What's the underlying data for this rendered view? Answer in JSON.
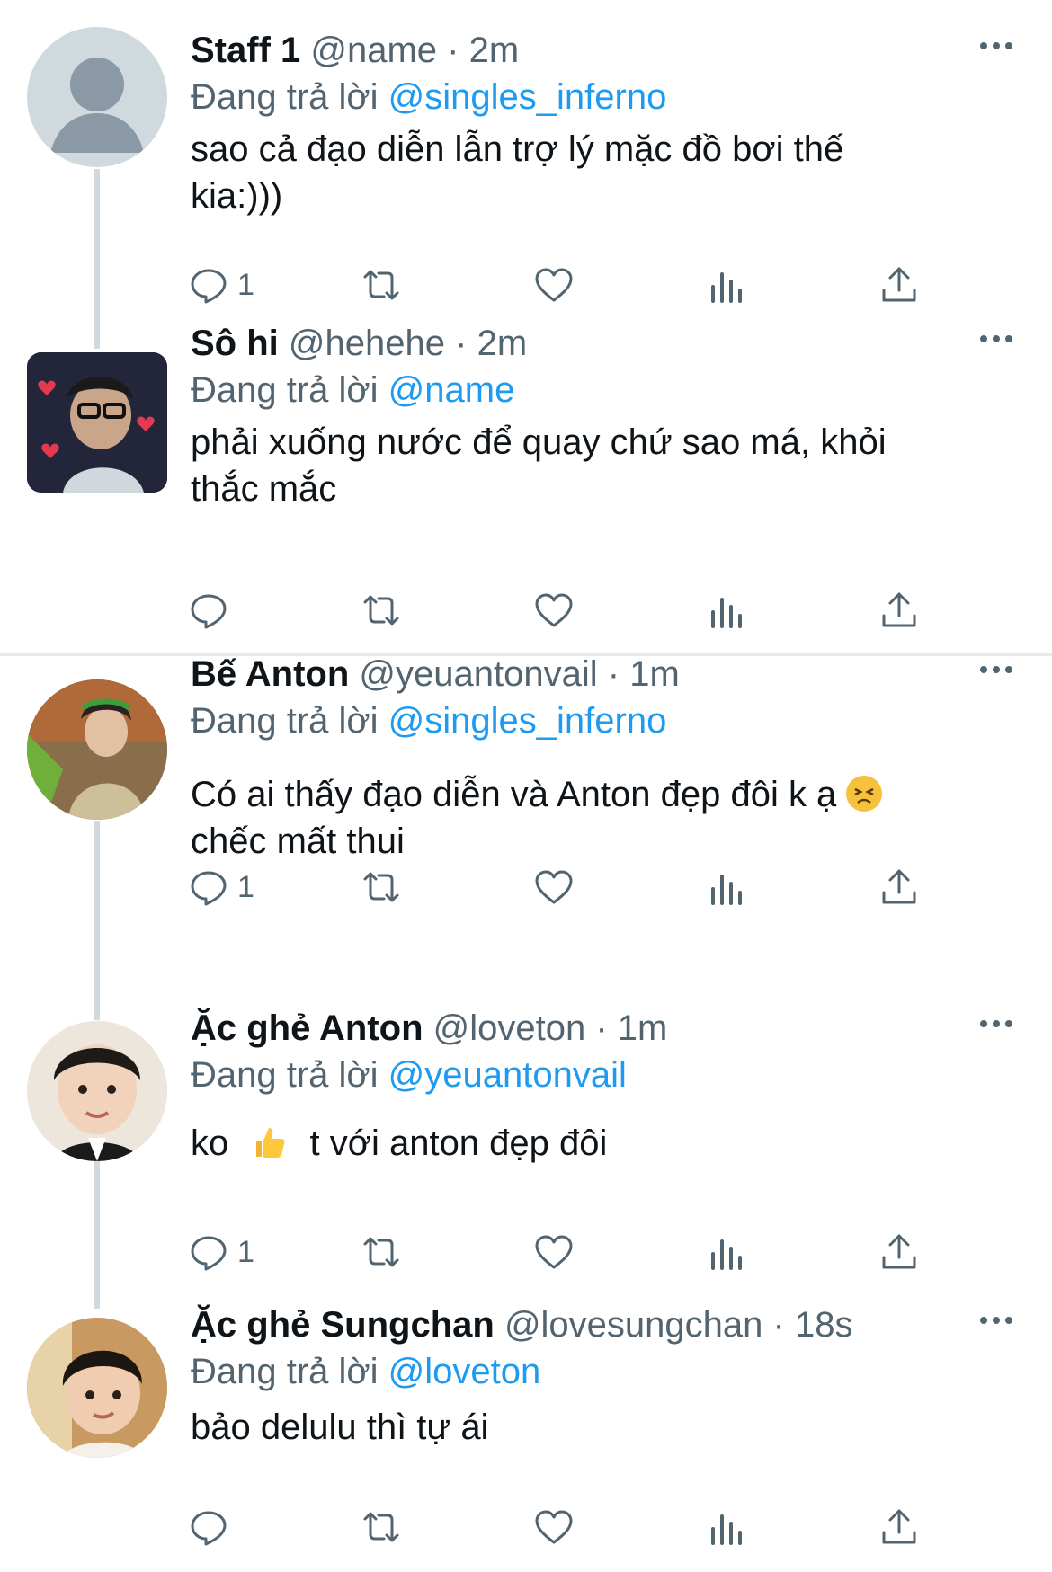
{
  "tweets": [
    {
      "name": "Staff 1",
      "handle": "@name",
      "time": "2m",
      "reply_prefix": "Đang trả lời",
      "reply_to": "@singles_inferno",
      "text_lines": [
        "sao cả đạo diễn lẫn trợ lý mặc đồ bơi thế",
        "kia:)))"
      ],
      "reply_count": "1"
    },
    {
      "name": "Sô hi",
      "handle": "@hehehe",
      "time": "2m",
      "reply_prefix": "Đang trả lời",
      "reply_to": "@name",
      "text_lines": [
        "phải xuống nước để quay chứ sao má, khỏi",
        "thắc mắc"
      ],
      "reply_count": ""
    },
    {
      "name": "Bế Anton",
      "handle": "@yeuantonvail",
      "time": "1m",
      "reply_prefix": "Đang trả lời",
      "reply_to": "@singles_inferno",
      "text_lines": [
        "Có ai thấy đạo diễn và Anton đẹp đôi k ạ",
        "chếc mất thui"
      ],
      "reply_count": "1"
    },
    {
      "name": "Ặc ghẻ Anton",
      "handle": "@loveton",
      "time": "1m",
      "reply_prefix": "Đang trả lời",
      "reply_to": "@yeuantonvail",
      "text_a": "ko",
      "text_b": "t với anton đẹp đôi",
      "reply_count": "1"
    },
    {
      "name": "Ặc ghẻ Sungchan",
      "handle": "@lovesungchan",
      "time": "18s",
      "reply_prefix": "Đang trả lời",
      "reply_to": "@loveton",
      "text_lines": [
        "bảo delulu thì tự ái"
      ],
      "reply_count": ""
    }
  ],
  "separator": "·",
  "colors": {
    "accent": "#1d9bf0",
    "secondary": "#536471",
    "thread_line": "#cfd9de"
  },
  "icons": {
    "reply": "speech-bubble-icon",
    "retweet": "retweet-arrows-icon",
    "like": "heart-icon",
    "views": "bar-chart-icon",
    "share": "share-upload-icon",
    "more": "ellipsis-icon"
  }
}
